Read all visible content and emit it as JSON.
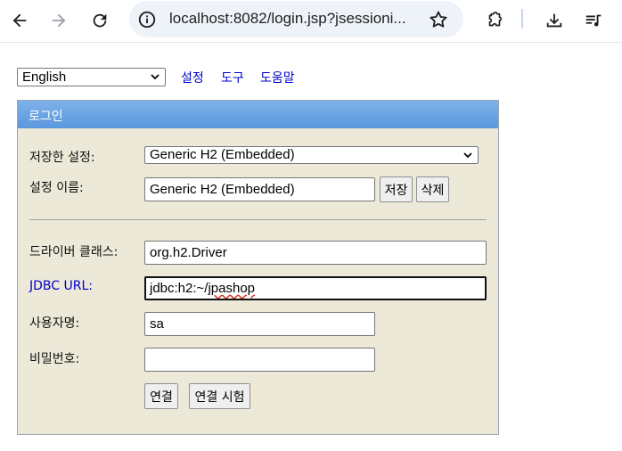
{
  "browser": {
    "url": "localhost:8082/login.jsp?jsessioni..."
  },
  "top": {
    "language_selected": "English",
    "links": [
      "설정",
      "도구",
      "도움말"
    ]
  },
  "panel": {
    "title": "로그인",
    "saved_settings_label": "저장한 설정:",
    "saved_settings_value": "Generic H2 (Embedded)",
    "setting_name_label": "설정 이름:",
    "setting_name_value": "Generic H2 (Embedded)",
    "save_button": "저장",
    "delete_button": "삭제",
    "driver_class_label": "드라이버 클래스:",
    "driver_class_value": "org.h2.Driver",
    "jdbc_url_label": "JDBC URL:",
    "jdbc_url_prefix": "jdbc:h2:~/",
    "jdbc_url_misspelled": "jpashop",
    "username_label": "사용자명:",
    "username_value": "sa",
    "password_label": "비밀번호:",
    "password_value": "",
    "connect_button": "연결",
    "test_connect_button": "연결 시험"
  }
}
